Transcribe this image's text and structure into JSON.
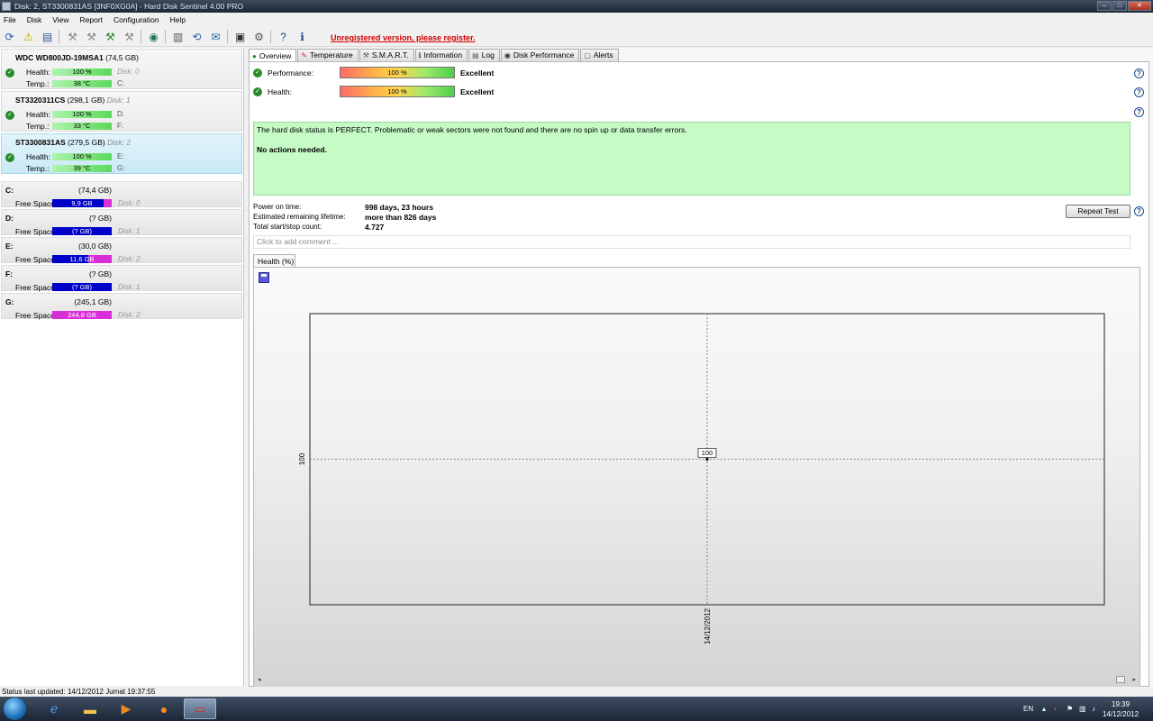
{
  "window": {
    "title": "Disk: 2, ST3300831AS [3NF0XG0A]  -  Hard Disk Sentinel 4.00 PRO",
    "min": "–",
    "max": "□",
    "close": "✕"
  },
  "menu": [
    "File",
    "Disk",
    "View",
    "Report",
    "Configuration",
    "Help"
  ],
  "toolbar": {
    "register_text": "Unregistered version, please register."
  },
  "disks": [
    {
      "name": "WDC WD800JD-19MSA1",
      "size": "(74,5 GB)",
      "disk_label": "",
      "health_label": "Health:",
      "health": "100 %",
      "health_extra": "Disk: 0",
      "temp_label": "Temp.:",
      "temp": "38 °C",
      "temp_extra": "C:"
    },
    {
      "name": "ST3320311CS",
      "size": "(298,1 GB)",
      "disk_label": "Disk: 1",
      "health_label": "Health:",
      "health": "100 %",
      "health_extra": "D:",
      "temp_label": "Temp.:",
      "temp": "33 °C",
      "temp_extra": "F:"
    },
    {
      "name": "ST3300831AS",
      "size": "(279,5 GB)",
      "disk_label": "Disk: 2",
      "health_label": "Health:",
      "health": "100 %",
      "health_extra": "E:",
      "temp_label": "Temp.:",
      "temp": "39 °C",
      "temp_extra": "G:"
    }
  ],
  "volumes": [
    {
      "letter": "C:",
      "size": "(74,4 GB)",
      "label": "Free Space",
      "free": "9,9 GB",
      "free_pct": 13,
      "disk": "Disk: 0"
    },
    {
      "letter": "D:",
      "size": "(? GB)",
      "label": "Free Space",
      "free": "(? GB)",
      "free_pct": 0,
      "disk": "Disk: 1"
    },
    {
      "letter": "E:",
      "size": "(30,0 GB)",
      "label": "Free Space",
      "free": "11,6 GB",
      "free_pct": 39,
      "disk": "Disk: 2"
    },
    {
      "letter": "F:",
      "size": "(? GB)",
      "label": "Free Space",
      "free": "(? GB)",
      "free_pct": 0,
      "disk": "Disk: 1"
    },
    {
      "letter": "G:",
      "size": "(245,1 GB)",
      "label": "Free Space",
      "free": "244,8 GB",
      "free_pct": 100,
      "disk": "Disk: 2"
    }
  ],
  "tabs": [
    "Overview",
    "Temperature",
    "S.M.A.R.T.",
    "Information",
    "Log",
    "Disk Performance",
    "Alerts"
  ],
  "overview": {
    "performance_label": "Performance:",
    "performance_value": "100 %",
    "performance_rating": "Excellent",
    "health_label": "Health:",
    "health_value": "100 %",
    "health_rating": "Excellent",
    "status_line1": "The hard disk status is PERFECT. Problematic or weak sectors were not found and there are no spin up or data transfer errors.",
    "status_line2": "No actions needed.",
    "power_on_label": "Power on time:",
    "power_on_value": "998 days, 23 hours",
    "lifetime_label": "Estimated remaining lifetime:",
    "lifetime_value": "more than 826 days",
    "startstop_label": "Total start/stop count:",
    "startstop_value": "4.727",
    "repeat_test": "Repeat Test",
    "comment_placeholder": "Click to add comment ...",
    "chart_tab": "Health (%)"
  },
  "chart_data": {
    "type": "line",
    "x": [
      "14/12/2012"
    ],
    "series": [
      {
        "values": [
          100
        ]
      }
    ],
    "tick_y": "100",
    "data_label": "100"
  },
  "statusbar": "Status last updated: 14/12/2012 Jumat 19:37:55",
  "taskbar": {
    "lang": "EN",
    "time": "19:39",
    "date": "14/12/2012"
  }
}
